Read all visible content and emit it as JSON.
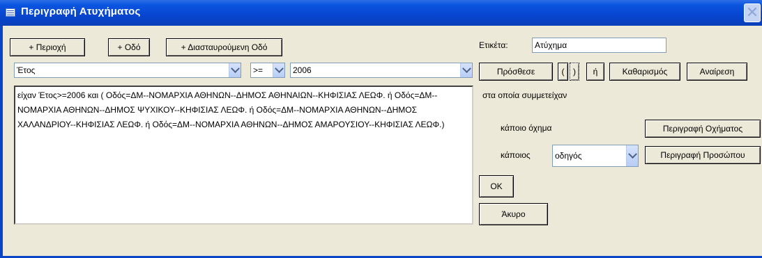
{
  "window": {
    "title": "Περιγραφή Ατυχήματος",
    "close_symbol": "✕"
  },
  "toolbar": {
    "add_area_label": "+ Περιοχή",
    "add_street_label": "+ Οδό",
    "add_cross_street_label": "+ Διασταυρούμενη Οδό"
  },
  "filter": {
    "field_value": "Έτος",
    "operator_value": ">=",
    "value_value": "2006"
  },
  "query": {
    "text": "είχαν  Έτος>=2006 και ( Οδός=ΔΜ--ΝΟΜΑΡΧΙΑ ΑΘΗΝΩΝ--ΔΗΜΟΣ ΑΘΗΝΑΙΩΝ--ΚΗΦΙΣΙΑΣ ΛΕΩΦ. ή  Οδός=ΔΜ--ΝΟΜΑΡΧΙΑ ΑΘΗΝΩΝ--ΔΗΜΟΣ ΨΥΧΙΚΟΥ--ΚΗΦΙΣΙΑΣ ΛΕΩΦ. ή  Οδός=ΔΜ--ΝΟΜΑΡΧΙΑ ΑΘΗΝΩΝ--ΔΗΜΟΣ ΧΑΛΑΝΔΡΙΟΥ--ΚΗΦΙΣΙΑΣ ΛΕΩΦ. ή  Οδός=ΔΜ--ΝΟΜΑΡΧΙΑ ΑΘΗΝΩΝ--ΔΗΜΟΣ ΑΜΑΡΟΥΣΙΟΥ--ΚΗΦΙΣΙΑΣ ΛΕΩΦ.)"
  },
  "right_panel": {
    "label_caption": "Ετικέτα:",
    "label_value": "Ατύχημα",
    "add_button": "Πρόσθεσε",
    "open_paren_button": "(",
    "close_paren_button": ")",
    "or_button": "ή",
    "clear_button": "Καθαρισμός",
    "undo_button": "Αναίρεση",
    "participants_text": "στα οποία συμμετείχαν",
    "vehicle_text": "κάποιο όχημα",
    "vehicle_button": "Περιγραφή Οχήματος",
    "person_prefix": "κάποιος",
    "person_value": "οδηγός",
    "person_button": "Περιγραφή Προσώπου",
    "ok_button": "OK",
    "cancel_button": "Άκυρο"
  }
}
